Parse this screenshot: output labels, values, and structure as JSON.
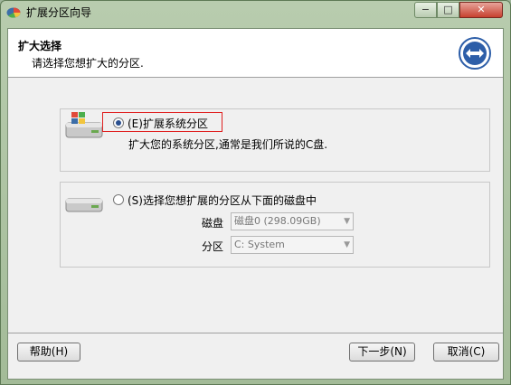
{
  "window": {
    "title": "扩展分区向导",
    "controls": {
      "minimize": "−",
      "maximize": "□",
      "close": "✕"
    }
  },
  "header": {
    "title": "扩大选择",
    "subtitle": "请选择您想扩大的分区."
  },
  "options": [
    {
      "label": "(E)扩展系统分区",
      "description": "扩大您的系统分区,通常是我们所说的C盘.",
      "selected": true
    },
    {
      "label": "(S)选择您想扩展的分区从下面的磁盘中",
      "selected": false,
      "fields": {
        "disk_label": "磁盘",
        "disk_value": "磁盘0 (298.09GB)",
        "partition_label": "分区",
        "partition_value": "C: System"
      }
    }
  ],
  "footer": {
    "help": "帮助(H)",
    "next": "下一步(N)",
    "cancel": "取消(C)"
  },
  "colors": {
    "highlight": "#e02020",
    "accent": "#2a4f8f"
  }
}
